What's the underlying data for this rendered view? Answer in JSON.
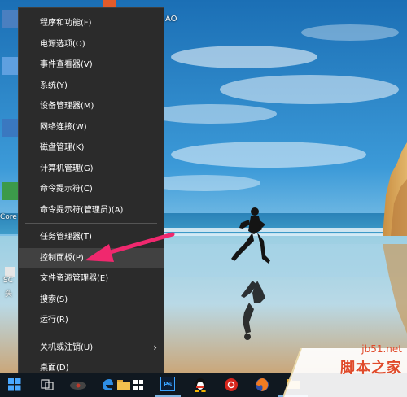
{
  "menu": {
    "groups": [
      [
        {
          "label": "程序和功能(F)"
        },
        {
          "label": "电源选项(O)"
        },
        {
          "label": "事件查看器(V)"
        },
        {
          "label": "系统(Y)"
        },
        {
          "label": "设备管理器(M)"
        },
        {
          "label": "网络连接(W)"
        },
        {
          "label": "磁盘管理(K)"
        },
        {
          "label": "计算机管理(G)"
        },
        {
          "label": "命令提示符(C)"
        },
        {
          "label": "命令提示符(管理员)(A)"
        }
      ],
      [
        {
          "label": "任务管理器(T)"
        },
        {
          "label": "控制面板(P)",
          "highlighted": true
        },
        {
          "label": "文件资源管理器(E)"
        },
        {
          "label": "搜索(S)"
        },
        {
          "label": "运行(R)"
        }
      ],
      [
        {
          "label": "关机或注销(U)",
          "has_submenu": true
        },
        {
          "label": "桌面(D)"
        }
      ]
    ]
  },
  "desktop": {
    "top_label_fragment": "AO",
    "left_labels": [
      "Core",
      "SC",
      "头"
    ]
  },
  "taskbar": {
    "items": [
      "windows-start",
      "task-view",
      "media-app",
      "edge",
      "file-explorer",
      "store",
      "photoshop",
      "qq",
      "netease-music",
      "firefox",
      "folder"
    ],
    "photoshop_label": "Ps"
  },
  "watermark": {
    "site": "jb51.net",
    "name": "脚本之家"
  },
  "colors": {
    "menu_bg": "#2b2b2b",
    "menu_highlight": "#414141",
    "arrow": "#f0286e",
    "taskbar": "#101820"
  }
}
